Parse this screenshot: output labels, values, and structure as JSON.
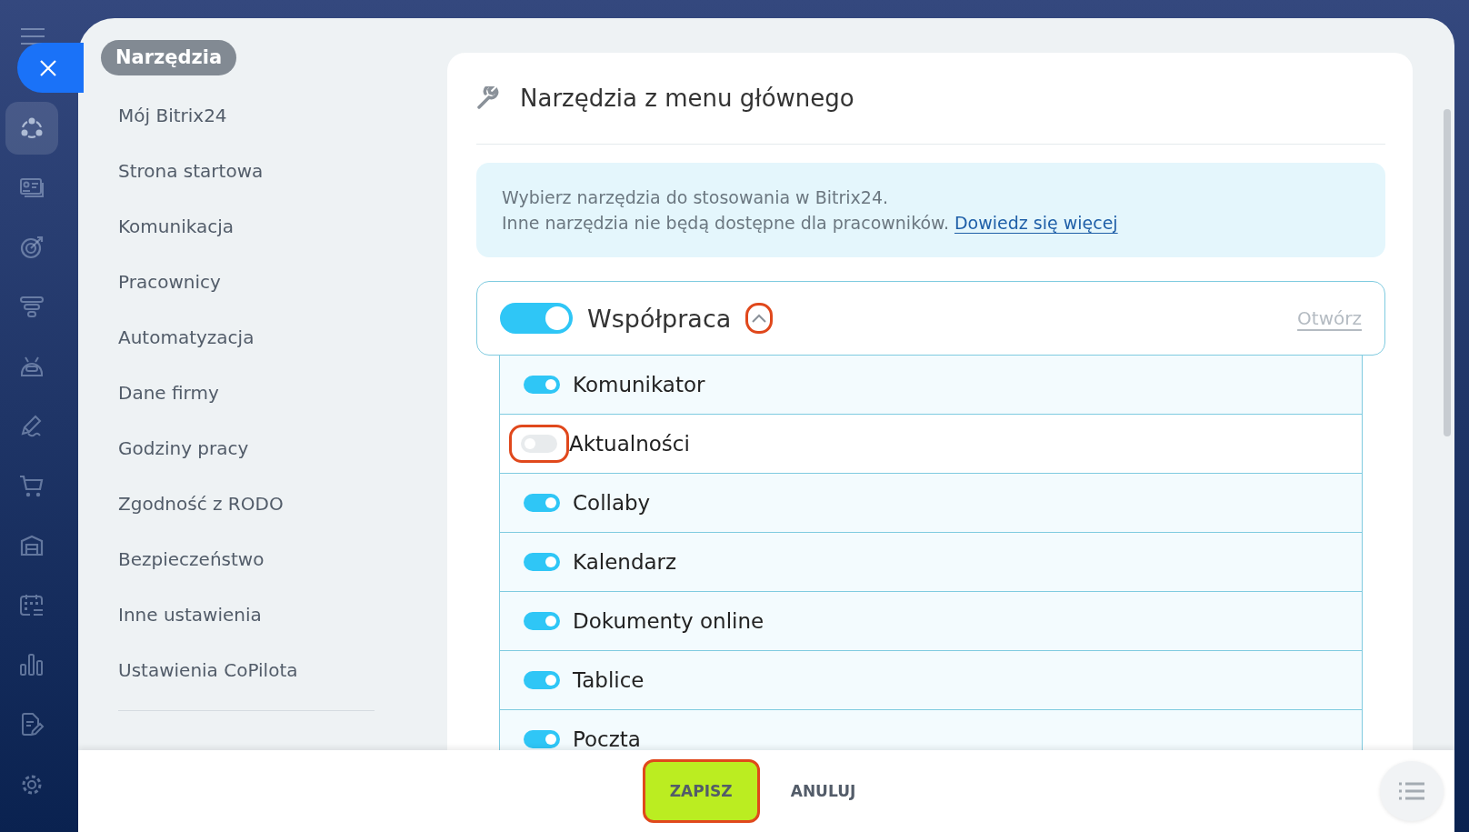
{
  "rail": {
    "items": [
      {
        "kind": "share",
        "selected": true
      },
      {
        "kind": "contact",
        "selected": false
      },
      {
        "kind": "target",
        "selected": false
      },
      {
        "kind": "funnel",
        "selected": false
      },
      {
        "kind": "robot",
        "selected": false
      },
      {
        "kind": "pencil",
        "selected": false
      },
      {
        "kind": "cart",
        "selected": false
      },
      {
        "kind": "warehouse",
        "selected": false
      },
      {
        "kind": "calendar",
        "selected": false
      },
      {
        "kind": "chart",
        "selected": false
      },
      {
        "kind": "document",
        "selected": false
      },
      {
        "kind": "gear",
        "selected": false
      }
    ]
  },
  "menu": {
    "heading": "Narzędzia",
    "items": [
      "Mój Bitrix24",
      "Strona startowa",
      "Komunikacja",
      "Pracownicy",
      "Automatyzacja",
      "Dane firmy",
      "Godziny pracy",
      "Zgodność z RODO",
      "Bezpieczeństwo",
      "Inne ustawienia",
      "Ustawienia CoPilota"
    ]
  },
  "card": {
    "title": "Narzędzia z menu głównego",
    "info": {
      "line_1": "Wybierz narzędzia do stosowania w Bitrix24.",
      "line_2": "Inne narzędzia nie będą dostępne dla pracowników.",
      "link": "Dowiedz się więcej"
    },
    "group": {
      "label": "Współpraca",
      "on": true,
      "expanded": true,
      "highlighted": true,
      "open_link": "Otwórz",
      "items": [
        {
          "label": "Komunikator",
          "on": true,
          "highlighted": false
        },
        {
          "label": "Aktualności",
          "on": false,
          "highlighted": true
        },
        {
          "label": "Collaby",
          "on": true,
          "highlighted": false
        },
        {
          "label": "Kalendarz",
          "on": true,
          "highlighted": false
        },
        {
          "label": "Dokumenty online",
          "on": true,
          "highlighted": false
        },
        {
          "label": "Tablice",
          "on": true,
          "highlighted": false
        },
        {
          "label": "Poczta",
          "on": true,
          "highlighted": false
        }
      ]
    }
  },
  "footer": {
    "save": {
      "label": "ZAPISZ",
      "highlighted": true
    },
    "cancel": {
      "label": "ANULUJ"
    }
  }
}
